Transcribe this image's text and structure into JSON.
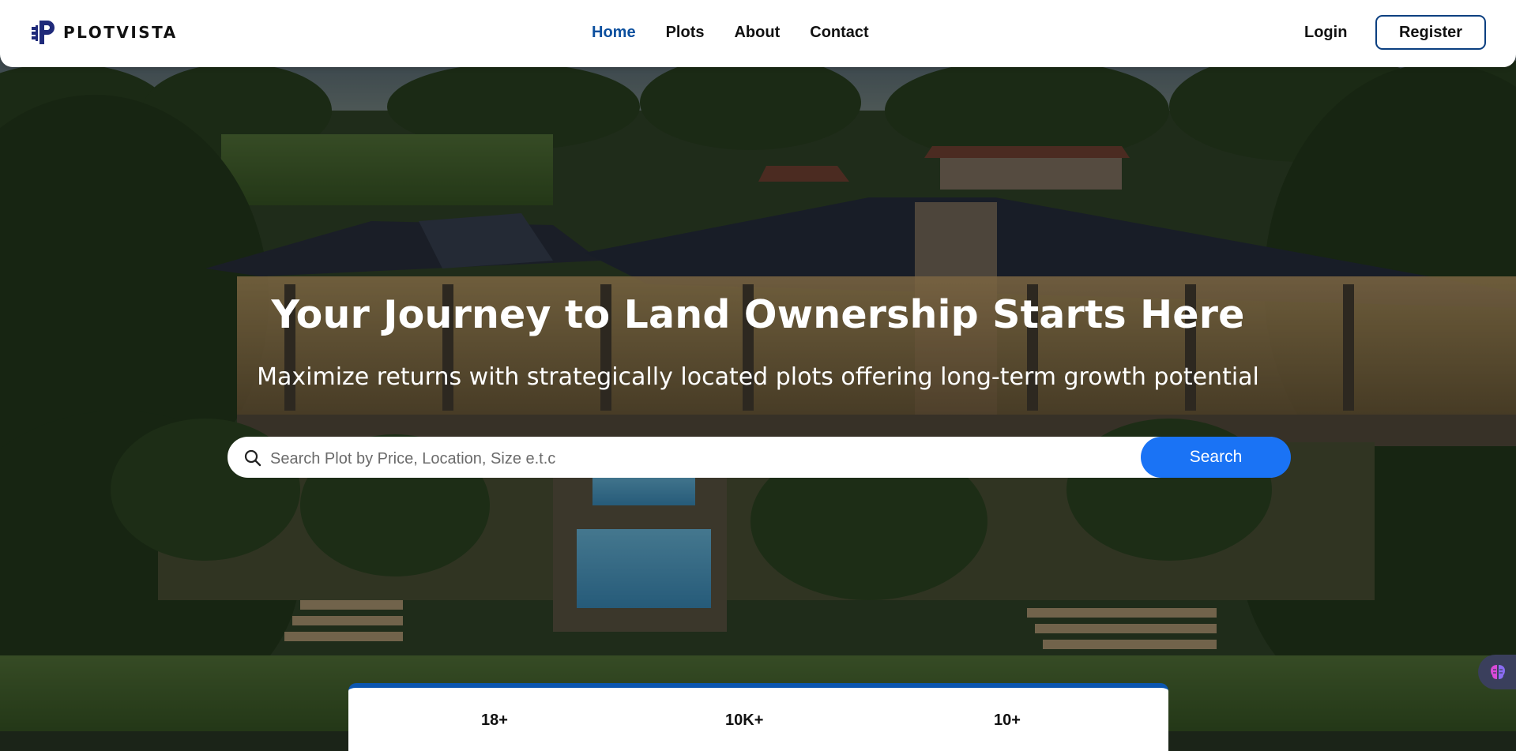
{
  "brand": {
    "name": "PLOTVISTA",
    "logo_icon": "plotvista-logo-icon",
    "color": "#1f2a7a"
  },
  "nav": {
    "links": [
      {
        "label": "Home",
        "active": true
      },
      {
        "label": "Plots",
        "active": false
      },
      {
        "label": "About",
        "active": false
      },
      {
        "label": "Contact",
        "active": false
      }
    ],
    "login_label": "Login",
    "register_label": "Register"
  },
  "hero": {
    "headline": "Your Journey to Land Ownership Starts Here",
    "subheadline": "Maximize returns with strategically located plots offering long-term growth potential"
  },
  "search": {
    "placeholder": "Search Plot by Price, Location, Size e.t.c",
    "value": "",
    "button_label": "Search",
    "icon": "search-icon"
  },
  "stats": [
    {
      "value": "18+"
    },
    {
      "value": "10K+"
    },
    {
      "value": "10+"
    }
  ],
  "widget": {
    "icon": "brain-icon"
  },
  "colors": {
    "accent": "#1a73f5",
    "nav_active": "#0b4f9e",
    "register_border": "#0b3f80",
    "stats_border": "#0b56b0"
  }
}
